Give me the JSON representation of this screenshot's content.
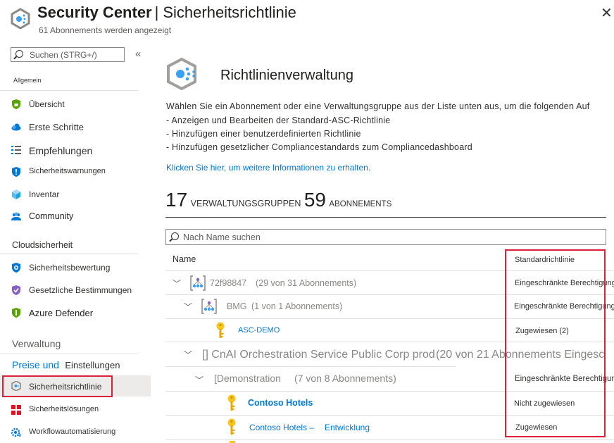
{
  "header": {
    "title": "Security Center",
    "separator": "|",
    "subtitle": "Sicherheitsrichtlinie",
    "count_text": "61 Abonnements werden angezeigt"
  },
  "sidebar": {
    "search_placeholder": "Suchen (STRG+/)",
    "collapse": "«",
    "sections": {
      "general": "Allgemein",
      "cloud": "Cloudsicherheit",
      "management": "Verwaltung"
    },
    "items": {
      "overview": "Übersicht",
      "getting_started": "Erste Schritte",
      "recommendations": "Empfehlungen",
      "alerts": "Sicherheitswarnungen",
      "inventory": "Inventar",
      "community": "Community",
      "secure_score": "Sicherheitsbewertung",
      "compliance": "Gesetzliche Bestimmungen",
      "defender": "Azure Defender",
      "pricing_a": "Preise und",
      "pricing_b": "Einstellungen",
      "policy": "Sicherheitsrichtlinie",
      "solutions": "Sicherheitslösungen",
      "workflow": "Workflowautomatisierung"
    }
  },
  "main": {
    "title": "Richtlinienverwaltung",
    "description": "Wählen Sie ein Abonnement oder eine Verwaltungsgruppe aus der Liste unten aus, um die folgenden Auf",
    "bullets": [
      "- Anzeigen und Bearbeiten der Standard-ASC-Richtlinie",
      "- Hinzufügen einer benutzerdefinierten Richtlinie",
      "- Hinzufügen gesetzlicher Compliancestandards zum Compliancedashboard"
    ],
    "link": "Klicken Sie hier, um weitere Informationen zu erhalten.",
    "counts": {
      "groups_value": "17",
      "groups_label": "VERWALTUNGSGRUPPEN",
      "subs_value": "59",
      "subs_label": "ABONNEMENTS"
    },
    "filter_placeholder": "Nach Name suchen",
    "columns": {
      "name": "Name",
      "policy": "Standardrichtlinie"
    },
    "rows": [
      {
        "name": "72f98847",
        "detail": "(29 von 31 Abonnements)",
        "status": "Eingeschränkte Berechtigung"
      },
      {
        "name": "BMG",
        "detail": "(1 von 1 Abonnements)",
        "status": "Eingeschränkte Berechtigung"
      },
      {
        "name": "ASC-DEMO",
        "detail": "",
        "status": "Zugewiesen (2)"
      },
      {
        "name": "[] CnAI Orchestration Service Public Corp prod",
        "detail": "(20 von 21 Abonnements Eingesc",
        "status": ""
      },
      {
        "name": "[Demonstration",
        "detail": "(7 von 8 Abonnements)",
        "status": "Eingeschränkte Berechtigung"
      },
      {
        "name": "Contoso Hotels",
        "detail": "",
        "status": "Nicht zugewiesen"
      },
      {
        "name": "Contoso Hotels –",
        "detail": "Entwicklung",
        "status": "Zugewiesen"
      }
    ]
  },
  "colors": {
    "accent": "#0078d4",
    "highlight": "#dc1f3a",
    "key": "#f8c51c"
  }
}
